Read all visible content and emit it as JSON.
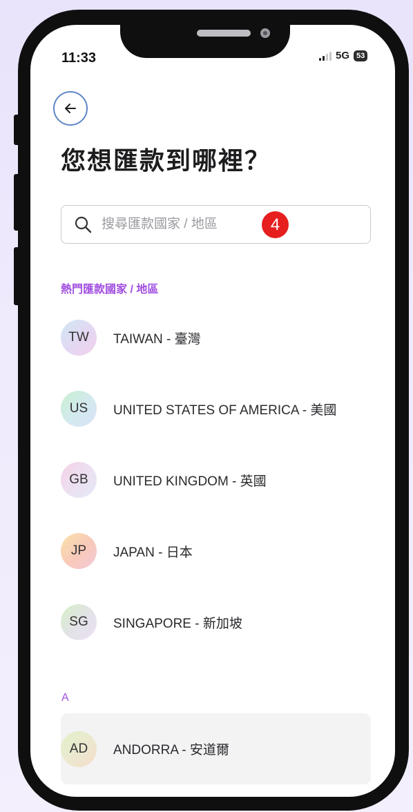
{
  "status_bar": {
    "time": "11:33",
    "network": "5G",
    "battery": "53"
  },
  "header": {
    "title": "您想匯款到哪裡？"
  },
  "search": {
    "placeholder": "搜尋匯款國家 / 地區",
    "value": ""
  },
  "annotation": {
    "step": "4"
  },
  "popular": {
    "label": "熱門匯款國家 / 地區",
    "items": [
      {
        "code": "TW",
        "name": "TAIWAN - 臺灣"
      },
      {
        "code": "US",
        "name": "UNITED STATES OF AMERICA - 美國"
      },
      {
        "code": "GB",
        "name": "UNITED KINGDOM - 英國"
      },
      {
        "code": "JP",
        "name": "JAPAN - 日本"
      },
      {
        "code": "SG",
        "name": "SINGAPORE - 新加坡"
      }
    ]
  },
  "alphabet": {
    "label": "A",
    "items": [
      {
        "code": "AD",
        "name": "ANDORRA - 安道爾"
      }
    ]
  },
  "colors": {
    "accent": "#a14fe0",
    "back_ring": "#5e86c8",
    "badge": "#e61e1e"
  }
}
